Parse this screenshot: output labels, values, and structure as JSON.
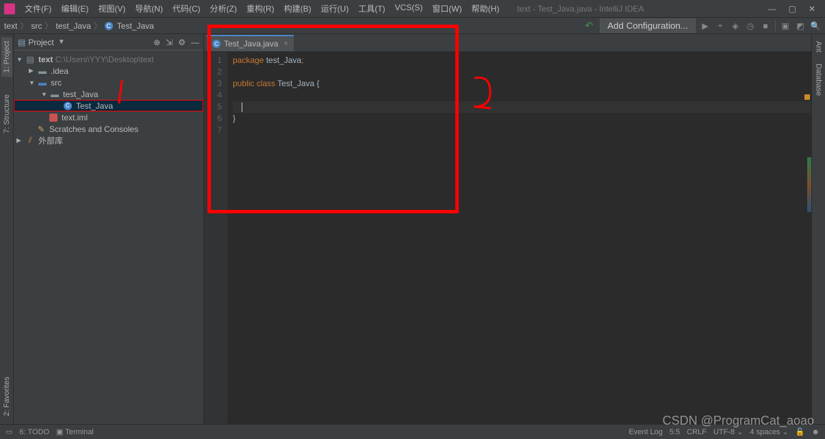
{
  "menu": {
    "file": "文件(F)",
    "edit": "编辑(E)",
    "view": "视图(V)",
    "nav": "导航(N)",
    "code": "代码(C)",
    "analyze": "分析(Z)",
    "refactor": "重构(R)",
    "build": "构建(B)",
    "run": "运行(U)",
    "tools": "工具(T)",
    "vcs": "VCS(S)",
    "window": "窗口(W)",
    "help": "帮助(H)"
  },
  "window_title": "text - Test_Java.java - IntelliJ IDEA",
  "breadcrumb": [
    "text",
    "src",
    "test_Java",
    "Test_Java"
  ],
  "add_config": "Add Configuration...",
  "left_tabs": {
    "project": "1: Project",
    "structure": "7: Structure",
    "favorites": "2: Favorites"
  },
  "right_tabs": {
    "ant": "Ant",
    "database": "Database"
  },
  "project_panel": {
    "title": "Project",
    "root": {
      "name": "text",
      "path": "C:\\Users\\YYY\\Desktop\\text"
    },
    "idea": ".idea",
    "src": "src",
    "pkg": "test_Java",
    "cls": "Test_Java",
    "iml": "text.iml",
    "scratches": "Scratches and Consoles",
    "external": "外部库"
  },
  "editor_tab": "Test_Java.java",
  "code": {
    "lines": [
      "1",
      "2",
      "3",
      "4",
      "5",
      "6",
      "7"
    ],
    "l1_kw": "package ",
    "l1_id": "test_Java",
    "l1_sc": ";",
    "l3_kw1": "public ",
    "l3_kw2": "class ",
    "l3_id": "Test_Java ",
    "l3_br": "{",
    "l5_indent": "    ",
    "l6": "}"
  },
  "status": {
    "todo": "6: TODO",
    "terminal": "Terminal",
    "pos": "5:5",
    "crlf": "CRLF",
    "enc": "UTF-8",
    "indent": "4 spaces",
    "eventlog": "Event Log"
  },
  "watermark": "CSDN @ProgramCat_aoao"
}
